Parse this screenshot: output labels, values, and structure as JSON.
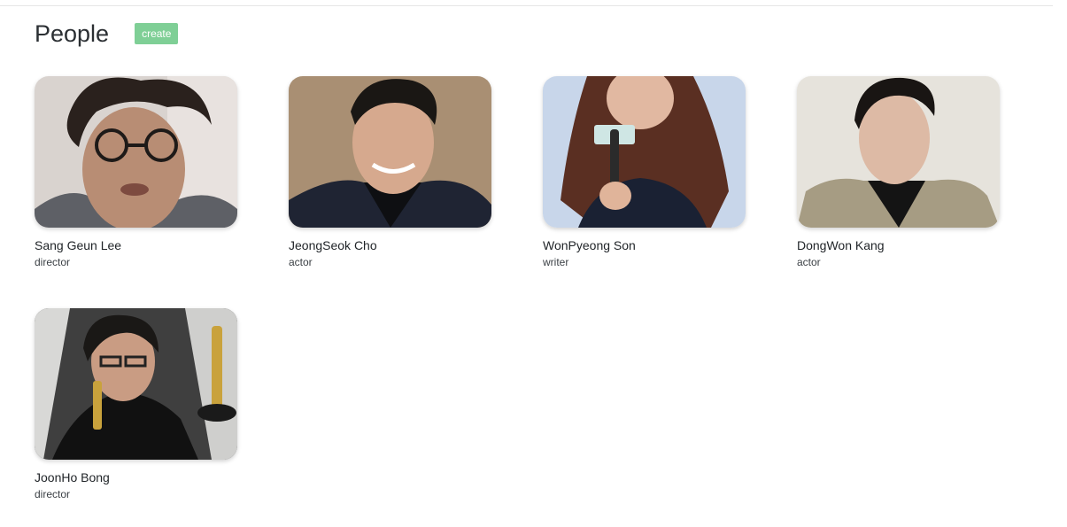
{
  "header": {
    "title": "People",
    "create_label": "create"
  },
  "people": [
    {
      "name": "Sang Geun Lee",
      "role": "director",
      "photo": "portrait-glasses-curly-hair"
    },
    {
      "name": "JeongSeok Cho",
      "role": "actor",
      "photo": "portrait-smiling-dark-suit"
    },
    {
      "name": "WonPyeong Son",
      "role": "writer",
      "photo": "portrait-microphone-long-hair"
    },
    {
      "name": "DongWon Kang",
      "role": "actor",
      "photo": "portrait-beige-jacket"
    },
    {
      "name": "JoonHo Bong",
      "role": "director",
      "photo": "portrait-holding-trophies"
    }
  ]
}
